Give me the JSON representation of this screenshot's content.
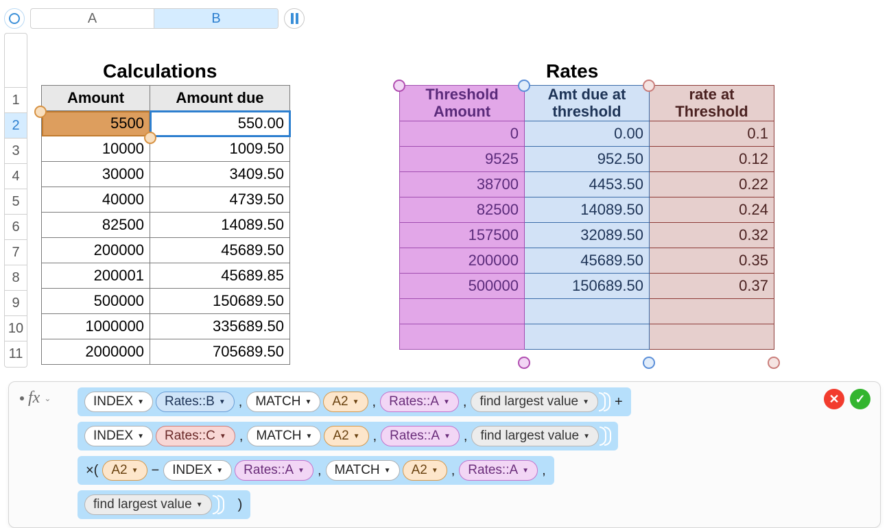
{
  "columns": {
    "A": "A",
    "B": "B"
  },
  "rows": [
    "1",
    "2",
    "3",
    "4",
    "5",
    "6",
    "7",
    "8",
    "9",
    "10",
    "11"
  ],
  "selected_row_index": 1,
  "calculations": {
    "title": "Calculations",
    "headers": {
      "A": "Amount",
      "B": "Amount due"
    },
    "rows": [
      {
        "A": "5500",
        "B": "550.00"
      },
      {
        "A": "10000",
        "B": "1009.50"
      },
      {
        "A": "30000",
        "B": "3409.50"
      },
      {
        "A": "40000",
        "B": "4739.50"
      },
      {
        "A": "82500",
        "B": "14089.50"
      },
      {
        "A": "200000",
        "B": "45689.50"
      },
      {
        "A": "200001",
        "B": "45689.85"
      },
      {
        "A": "500000",
        "B": "150689.50"
      },
      {
        "A": "1000000",
        "B": "335689.50"
      },
      {
        "A": "2000000",
        "B": "705689.50"
      }
    ]
  },
  "rates": {
    "title": "Rates",
    "headers": {
      "A": "Threshold Amount",
      "B": "Amt due at threshold",
      "C": "rate at Threshold"
    },
    "rows": [
      {
        "A": "0",
        "B": "0.00",
        "C": "0.1"
      },
      {
        "A": "9525",
        "B": "952.50",
        "C": "0.12"
      },
      {
        "A": "38700",
        "B": "4453.50",
        "C": "0.22"
      },
      {
        "A": "82500",
        "B": "14089.50",
        "C": "0.24"
      },
      {
        "A": "157500",
        "B": "32089.50",
        "C": "0.32"
      },
      {
        "A": "200000",
        "B": "45689.50",
        "C": "0.35"
      },
      {
        "A": "500000",
        "B": "150689.50",
        "C": "0.37"
      },
      {
        "A": "",
        "B": "",
        "C": ""
      },
      {
        "A": "",
        "B": "",
        "C": ""
      }
    ]
  },
  "formula": {
    "fx": "fx",
    "tokens": {
      "INDEX": "INDEX",
      "MATCH": "MATCH",
      "RatesA": "Rates::A",
      "RatesB": "Rates::B",
      "RatesC": "Rates::C",
      "A2": "A2",
      "findLargest": "find largest value",
      "plus": "+",
      "comma": ",",
      "times_open": "×(",
      "minus": "−",
      "close": ")"
    }
  }
}
